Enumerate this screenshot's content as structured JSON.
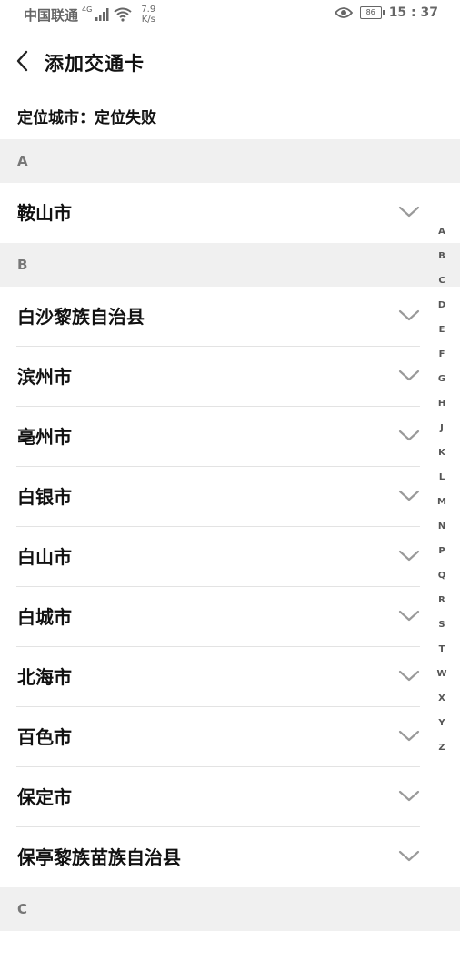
{
  "status_bar": {
    "carrier": "中国联通",
    "network": "4G",
    "speed_value": "7.9",
    "speed_unit": "K/s",
    "battery": "86",
    "time": "15 : 37"
  },
  "header": {
    "title": "添加交通卡"
  },
  "location": {
    "label": "定位城市：",
    "value": "定位失败"
  },
  "sections": [
    {
      "letter": "A",
      "cities": [
        "鞍山市"
      ]
    },
    {
      "letter": "B",
      "cities": [
        "白沙黎族自治县",
        "滨州市",
        "亳州市",
        "白银市",
        "白山市",
        "白城市",
        "北海市",
        "百色市",
        "保定市",
        "保亭黎族苗族自治县"
      ]
    },
    {
      "letter": "C",
      "cities": []
    }
  ],
  "index_letters": [
    "A",
    "B",
    "C",
    "D",
    "E",
    "F",
    "G",
    "H",
    "J",
    "K",
    "L",
    "M",
    "N",
    "P",
    "Q",
    "R",
    "S",
    "T",
    "W",
    "X",
    "Y",
    "Z"
  ]
}
